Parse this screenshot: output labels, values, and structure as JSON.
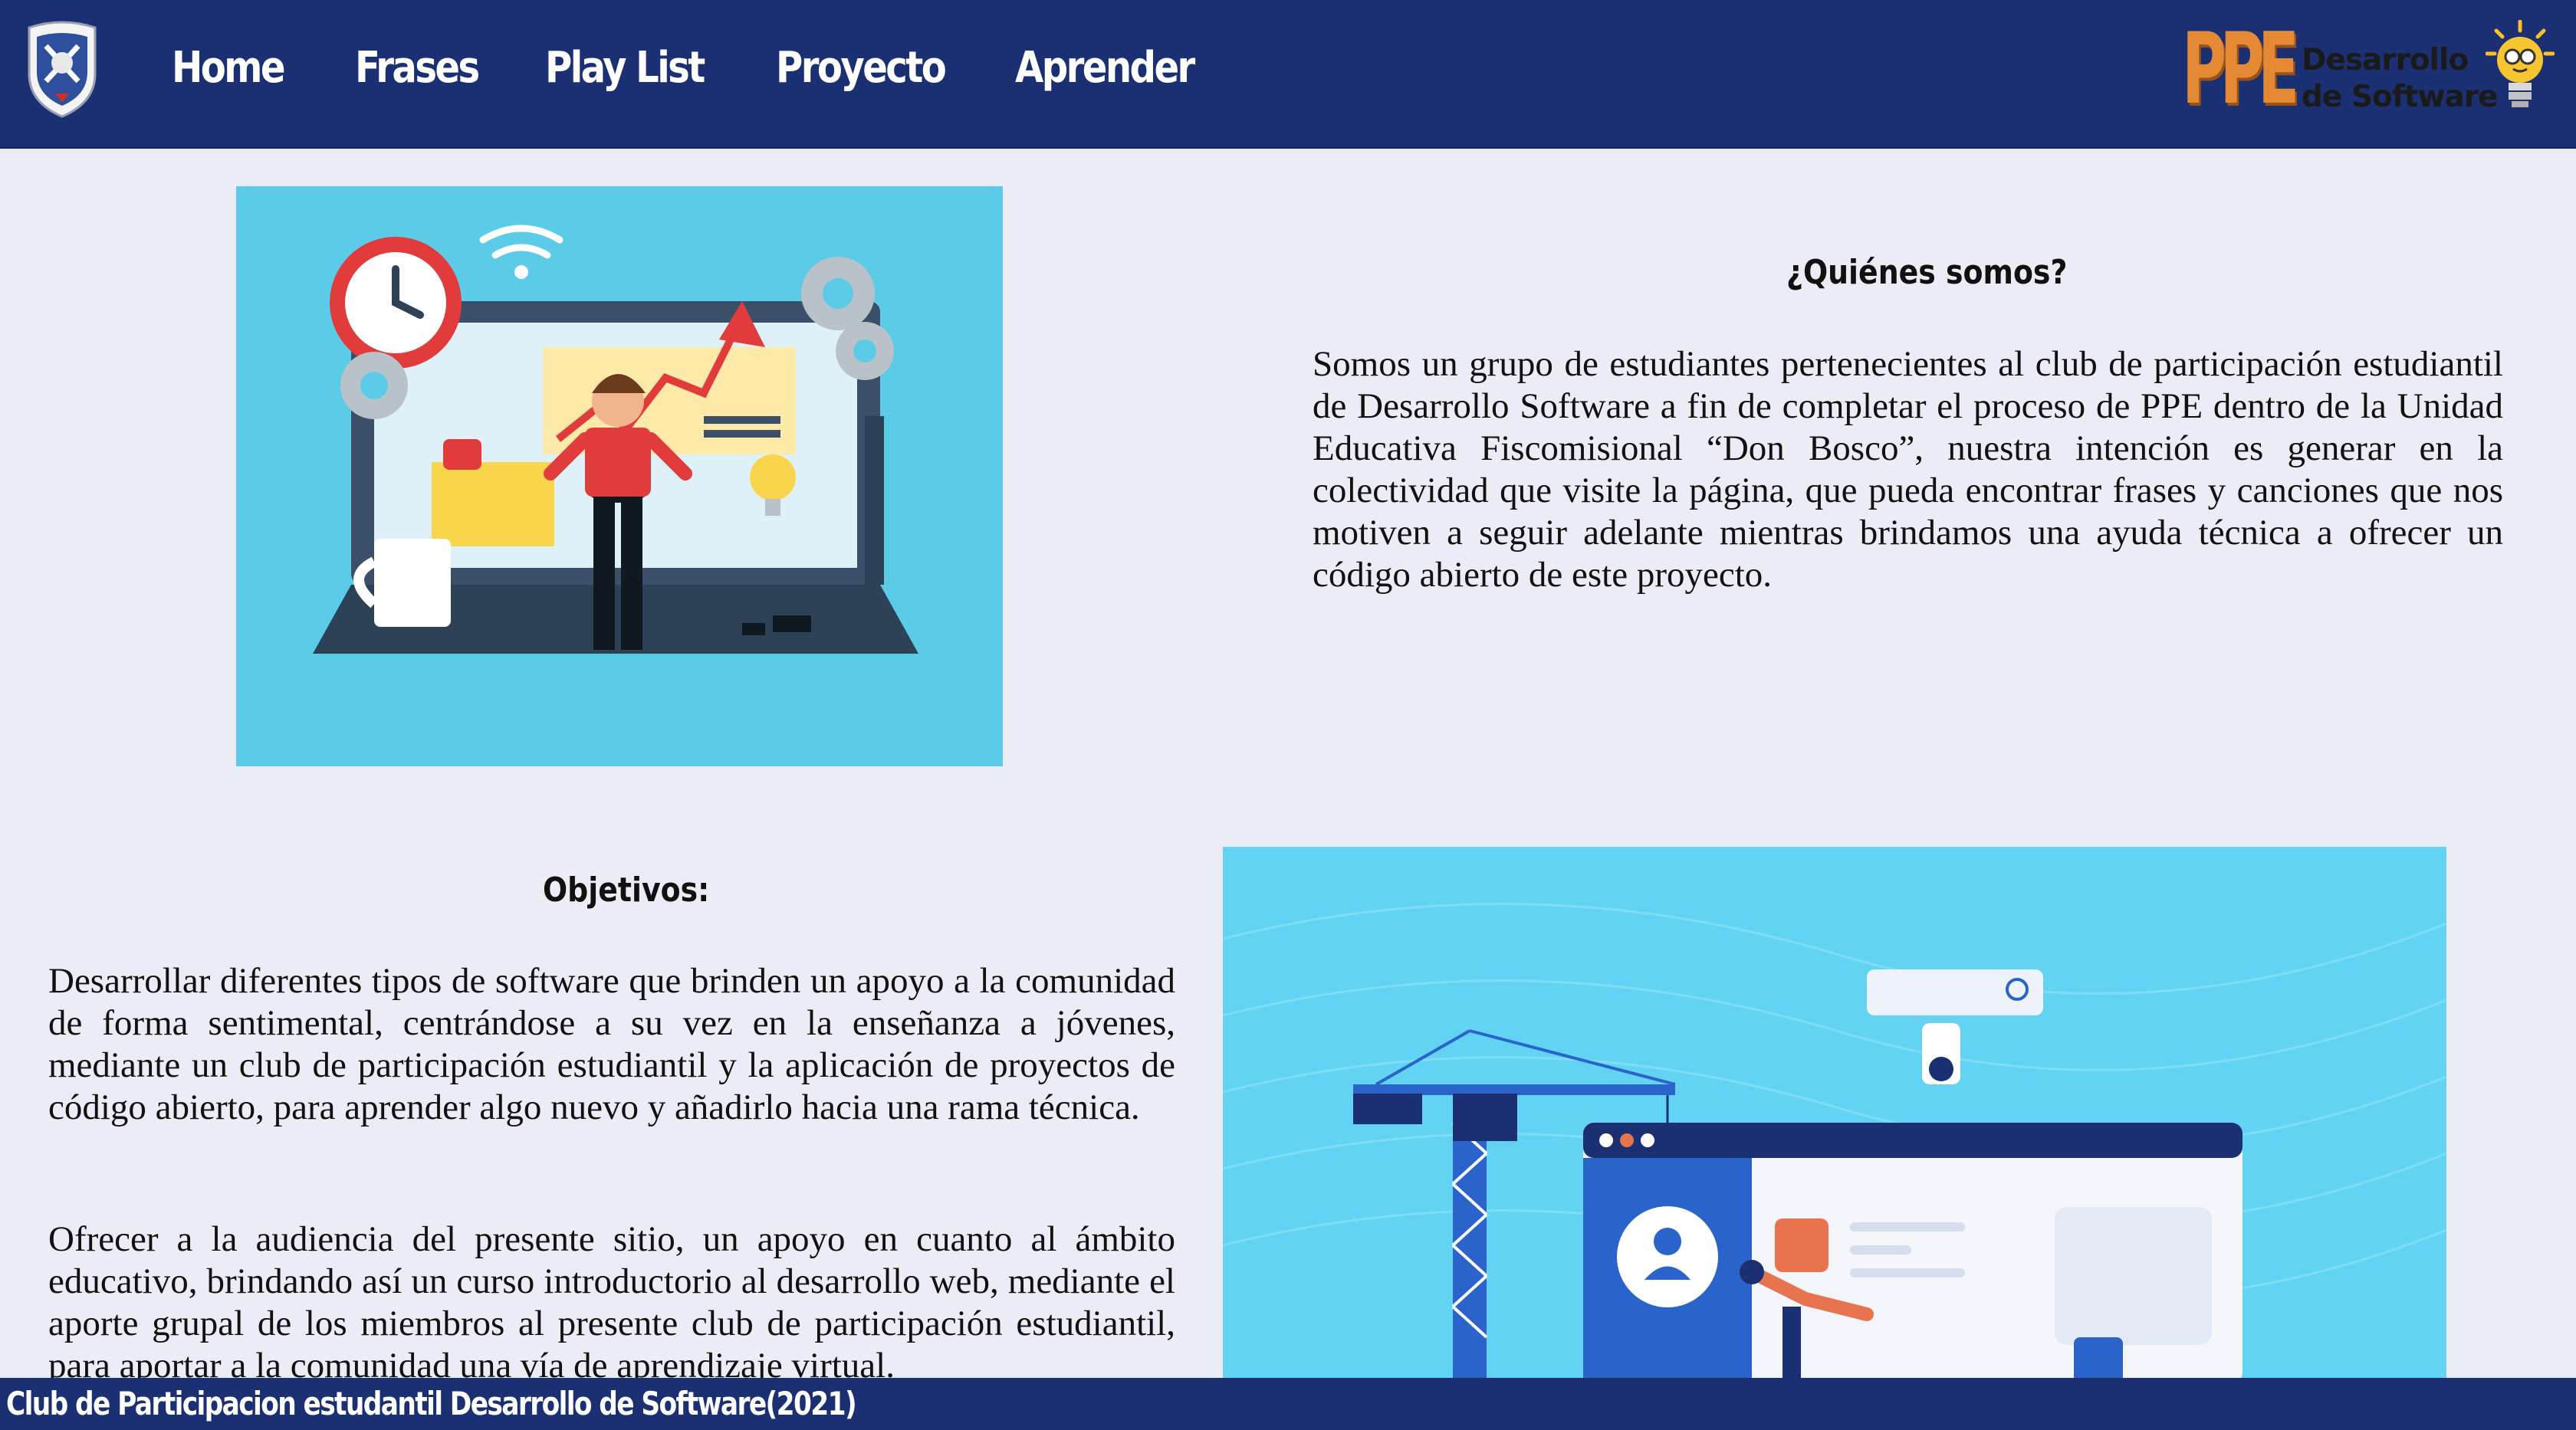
{
  "nav": {
    "items": [
      {
        "label": "Home"
      },
      {
        "label": "Frases"
      },
      {
        "label": "Play List"
      },
      {
        "label": "Proyecto"
      },
      {
        "label": "Aprender"
      }
    ]
  },
  "brand": {
    "ppe": "PPE",
    "line1": "Desarrollo",
    "line2": "de Software"
  },
  "about": {
    "title": "¿Quiénes somos?",
    "text": "Somos un grupo de estudiantes pertenecientes al club de participación estudiantil de Desarrollo Software a fin de completar el proceso de PPE dentro de la Unidad Educativa Fiscomisional “Don Bosco”, nuestra intención es generar en la colectividad que visite la página, que pueda encontrar frases y canciones que nos motiven a seguir adelante mientras brindamos una ayuda técnica a ofrecer un código abierto de este proyecto."
  },
  "goals": {
    "title": "Objetivos:",
    "text1": "Desarrollar diferentes tipos de software que brinden un apoyo a la comunidad de forma sentimental, centrándose a su vez en la enseñanza a jóvenes, mediante un club de participación estudiantil y la aplicación de proyectos de código abierto, para aprender algo nuevo y añadirlo hacia una rama técnica.",
    "text2": "Ofrecer a la audiencia del presente sitio, un apoyo en cuanto al ámbito educativo, brindando así un curso introductorio al desarrollo web, mediante el aporte grupal de los miembros al presente club de participación estudiantil, para aportar a la comunidad una vía de aprendizaje virtual."
  },
  "footer": {
    "text": "Club de Participacion estudantil Desarrollo de Software(2021)"
  },
  "colors": {
    "nav_bg": "#1b2f73",
    "page_bg": "#ebecf5",
    "brand_orange": "#e58934",
    "illus_blue": "#5bcbe7"
  }
}
